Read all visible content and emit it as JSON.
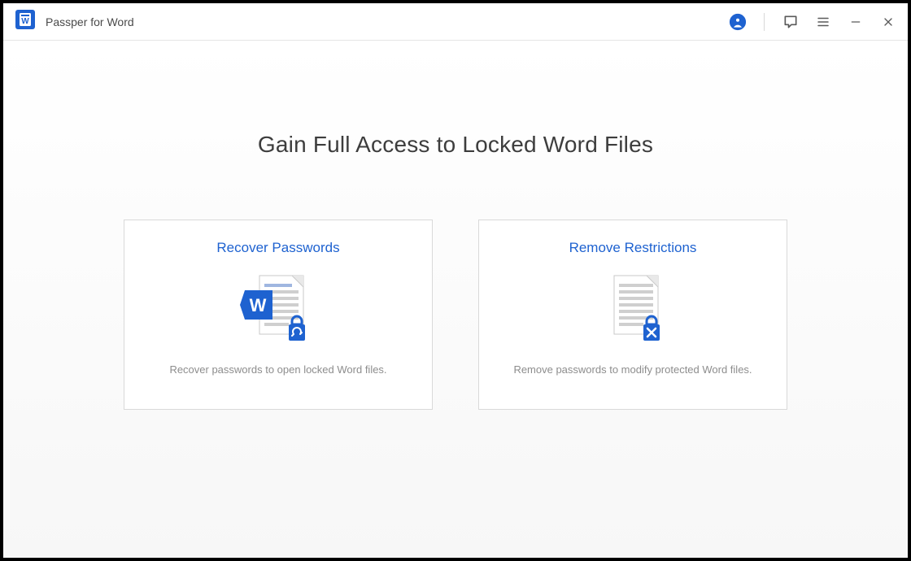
{
  "app": {
    "title": "Passper for Word"
  },
  "main": {
    "headline": "Gain Full Access to Locked Word Files",
    "cards": [
      {
        "title": "Recover Passwords",
        "desc": "Recover passwords to open locked Word files."
      },
      {
        "title": "Remove Restrictions",
        "desc": "Remove passwords to modify protected Word files."
      }
    ]
  }
}
